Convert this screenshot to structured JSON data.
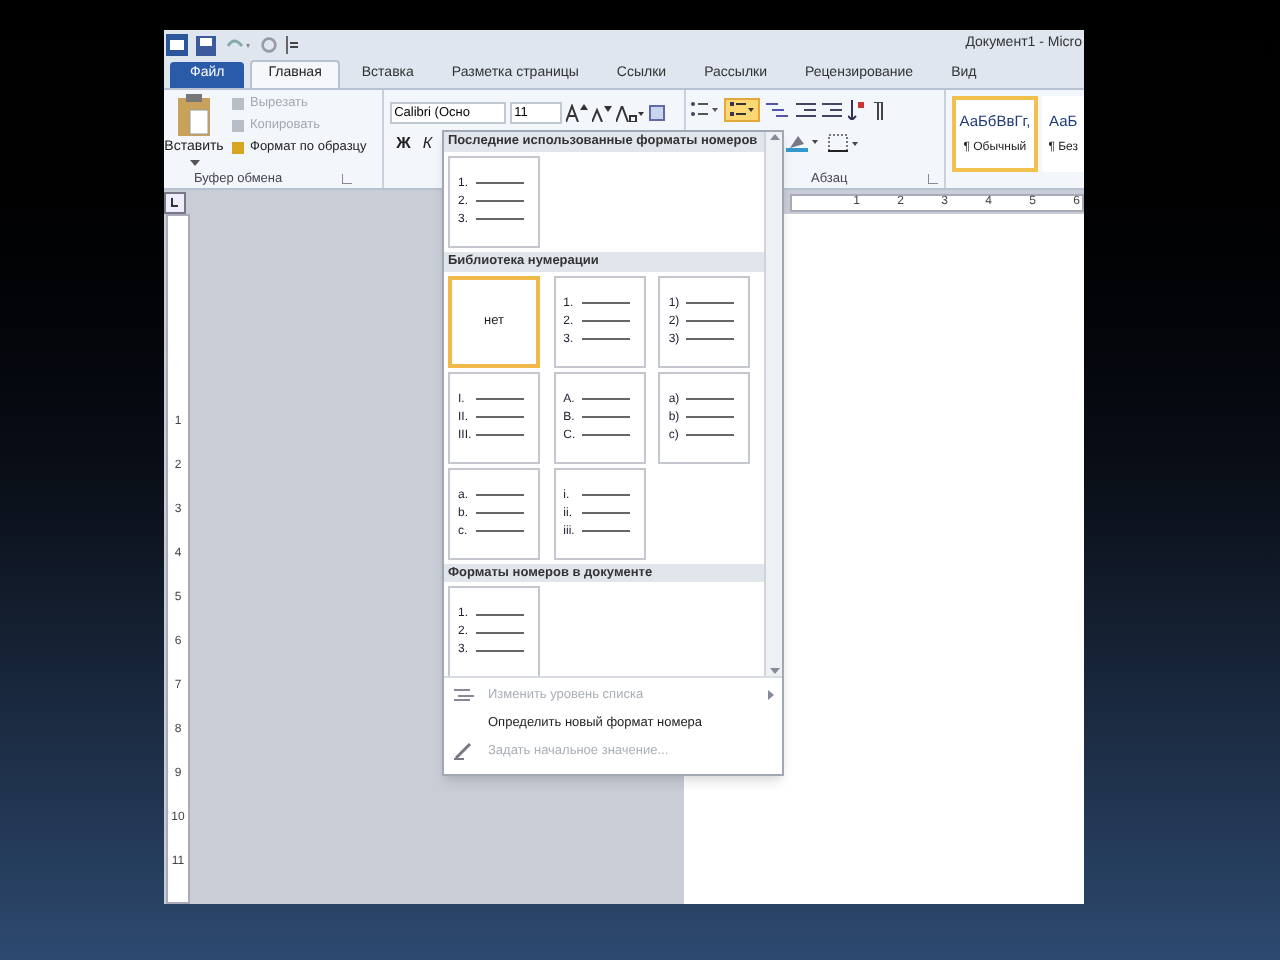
{
  "title_bar": {
    "title": "Документ1 - Micro"
  },
  "tabs": [
    {
      "label": "Файл",
      "kind": "file",
      "selected": false
    },
    {
      "label": "Главная",
      "kind": "tab",
      "selected": true
    },
    {
      "label": "Вставка",
      "kind": "tab",
      "selected": false
    },
    {
      "label": "Разметка страницы",
      "kind": "tab",
      "selected": false
    },
    {
      "label": "Ссылки",
      "kind": "tab",
      "selected": false
    },
    {
      "label": "Рассылки",
      "kind": "tab",
      "selected": false
    },
    {
      "label": "Рецензирование",
      "kind": "tab",
      "selected": false
    },
    {
      "label": "Вид",
      "kind": "tab",
      "selected": false
    }
  ],
  "clipboard": {
    "paste": "Вставить",
    "group_label": "Буфер обмена",
    "items": [
      {
        "label": "Вырезать",
        "disabled": true
      },
      {
        "label": "Копировать",
        "disabled": true
      },
      {
        "label": "Формат по образцу",
        "disabled": false
      }
    ]
  },
  "font": {
    "name": "Calibri (Осно",
    "size": "11",
    "bold": "Ж",
    "italic": "К"
  },
  "paragraph": {
    "group_label": "Абзац",
    "numbering_selected": true
  },
  "styles": [
    {
      "preview": "АаБбВвГг,",
      "label": "¶ Обычный",
      "selected": true
    },
    {
      "preview": "АаБ",
      "label": "¶ Без",
      "selected": false
    }
  ],
  "horizontal_ruler": [
    "1",
    "2",
    "3",
    "4",
    "5",
    "6"
  ],
  "vertical_ruler": [
    "1",
    "2",
    "3",
    "4",
    "5",
    "6",
    "7",
    "8",
    "9",
    "10",
    "11"
  ],
  "numbering_menu": {
    "sections": [
      {
        "title": "Последние использованные форматы номеров",
        "items": [
          {
            "kind": "list",
            "selected": false,
            "markers": [
              "1.",
              "2.",
              "3."
            ]
          }
        ]
      },
      {
        "title": "Библиотека нумерации",
        "items": [
          {
            "kind": "none",
            "label": "нет",
            "selected": true
          },
          {
            "kind": "list",
            "selected": false,
            "markers": [
              "1.",
              "2.",
              "3."
            ]
          },
          {
            "kind": "list",
            "selected": false,
            "markers": [
              "1)",
              "2)",
              "3)"
            ]
          },
          {
            "kind": "list",
            "selected": false,
            "markers": [
              "I.",
              "II.",
              "III."
            ]
          },
          {
            "kind": "list",
            "selected": false,
            "markers": [
              "A.",
              "B.",
              "C."
            ]
          },
          {
            "kind": "list",
            "selected": false,
            "markers": [
              "a)",
              "b)",
              "c)"
            ]
          },
          {
            "kind": "list",
            "selected": false,
            "markers": [
              "a.",
              "b.",
              "c."
            ]
          },
          {
            "kind": "list",
            "selected": false,
            "markers": [
              "i.",
              "ii.",
              "iii."
            ]
          }
        ]
      },
      {
        "title": "Форматы номеров в документе",
        "items": [
          {
            "kind": "list",
            "selected": false,
            "markers": [
              "1.",
              "2.",
              "3."
            ]
          }
        ]
      }
    ],
    "commands": [
      {
        "label": "Изменить уровень списка",
        "kind": "level",
        "disabled": true,
        "submenu": true
      },
      {
        "label": "Определить новый формат номера",
        "kind": "plain",
        "disabled": false,
        "submenu": false
      },
      {
        "label": "Задать начальное значение...",
        "kind": "start",
        "disabled": true,
        "submenu": false
      }
    ]
  }
}
